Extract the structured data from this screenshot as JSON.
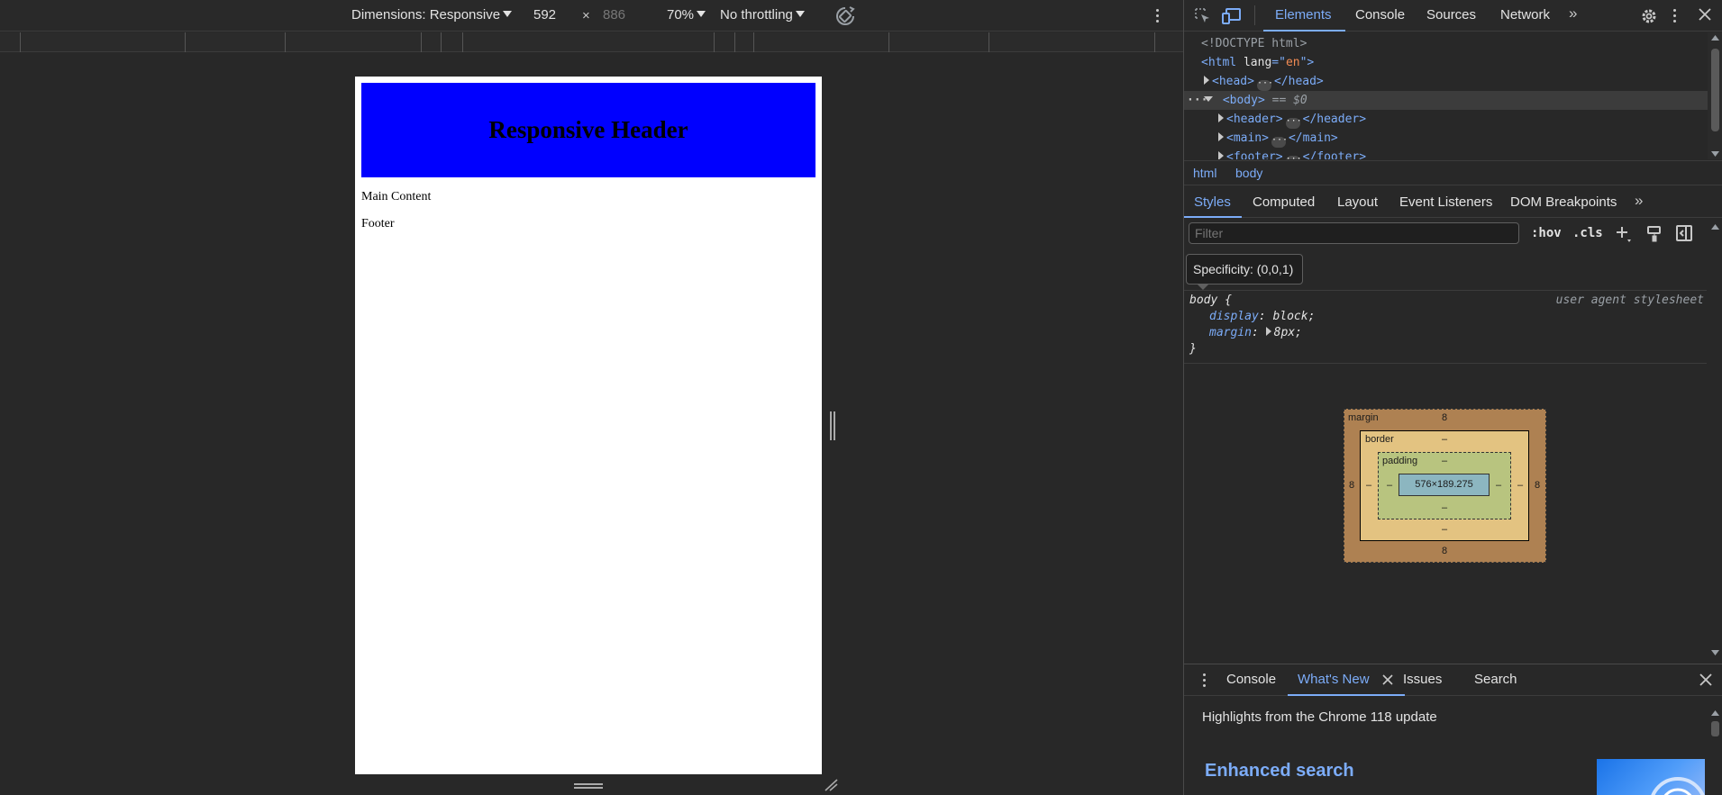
{
  "device_toolbar": {
    "dimensions_label": "Dimensions: Responsive",
    "width_value": "592",
    "times": "×",
    "height_value": "886",
    "zoom": "70%",
    "throttling": "No throttling"
  },
  "emulated_page": {
    "header_title": "Responsive Header",
    "main_text": "Main Content",
    "footer_text": "Footer"
  },
  "devtools": {
    "tabs": [
      "Elements",
      "Console",
      "Sources",
      "Network"
    ],
    "more_tabs": "»",
    "dom": {
      "doctype": "<!DOCTYPE html>",
      "html_open": "<html",
      "html_attr": "lang",
      "html_attr_eq": "=\"",
      "html_attr_value": "en",
      "html_attr_close": "\">",
      "head_open": "<head>",
      "head_close": "</head>",
      "body_open": "<body>",
      "body_ref": "== $0",
      "header_open": "<header>",
      "header_close": "</header>",
      "main_open": "<main>",
      "main_close": "</main>",
      "footer_partial": "<footer>",
      "footer_partial_close": "</footer>"
    },
    "breadcrumb": [
      "html",
      "body"
    ],
    "style_tabs": [
      "Styles",
      "Computed",
      "Layout",
      "Event Listeners",
      "DOM Breakpoints"
    ],
    "filter_placeholder": "Filter",
    "hov_label": ":hov",
    "cls_label": ".cls",
    "tooltip": "Specificity: (0,0,1)",
    "rule": {
      "selector": "body {",
      "source": "user agent stylesheet",
      "decl1_prop": "display",
      "decl1_val": "block;",
      "decl2_prop": "margin",
      "decl2_val": "8px;",
      "close": "}"
    },
    "box_model": {
      "margin_label": "margin",
      "border_label": "border",
      "padding_label": "padding",
      "content_size": "576×189.275",
      "margin_top": "8",
      "margin_bottom": "8",
      "margin_left": "8",
      "margin_right": "8",
      "border_top": "–",
      "border_bottom": "–",
      "border_left": "–",
      "border_right": "–",
      "padding_top": "–",
      "padding_bottom": "–",
      "padding_left": "–",
      "padding_right": "–"
    },
    "drawer": {
      "tabs": [
        "Console",
        "What's New",
        "Issues",
        "Search"
      ],
      "headline": "Highlights from the Chrome 118 update",
      "feature_title": "Enhanced search"
    }
  },
  "colors": {
    "accent": "#7cacf8",
    "page_header_bg": "#0000ff",
    "toolbar_bg": "#292929",
    "panel_bg": "#282828"
  },
  "icons": [
    "inspect-element-icon",
    "device-toggle-icon",
    "settings-gear-icon",
    "kebab-menu-icon",
    "rotate-icon",
    "new-style-rule-icon",
    "paint-icon",
    "sidebar-toggle-icon",
    "close-icon"
  ]
}
